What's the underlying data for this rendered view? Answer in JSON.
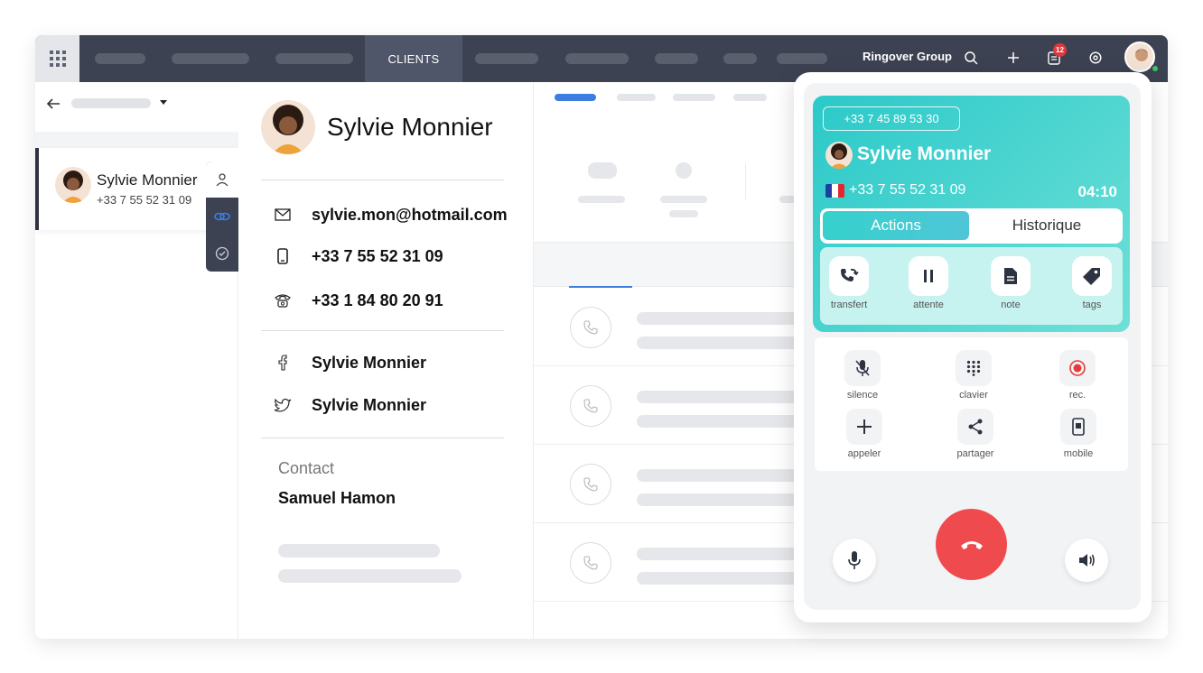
{
  "topbar": {
    "active_tab": "CLIENTS",
    "org_name": "Ringover Group",
    "notification_count": "12"
  },
  "contact_list": {
    "selected": {
      "name": "Sylvie Monnier",
      "phone": "+33 7 55 52 31 09"
    }
  },
  "contact_detail": {
    "name": "Sylvie Monnier",
    "email": "sylvie.mon@hotmail.com",
    "mobile": "+33 7 55 52 31 09",
    "landline": "+33 1 84 80 20 91",
    "facebook": "Sylvie Monnier",
    "twitter": "Sylvie Monnier",
    "contact_label": "Contact",
    "contact_owner": "Samuel Hamon"
  },
  "call": {
    "line_number": "+33 7 45 89 53 30",
    "caller_name": "Sylvie Monnier",
    "caller_phone": "+33 7 55 52 31 09",
    "duration": "04:10",
    "tabs": {
      "actions": "Actions",
      "history": "Historique"
    },
    "actions": [
      {
        "label": "transfert",
        "icon": "transfer-icon"
      },
      {
        "label": "attente",
        "icon": "pause-icon"
      },
      {
        "label": "note",
        "icon": "note-icon"
      },
      {
        "label": "tags",
        "icon": "tag-icon"
      }
    ],
    "controls": [
      {
        "label": "silence",
        "icon": "mute-icon"
      },
      {
        "label": "clavier",
        "icon": "keypad-icon"
      },
      {
        "label": "rec.",
        "icon": "record-icon"
      },
      {
        "label": "appeler",
        "icon": "plus-icon"
      },
      {
        "label": "partager",
        "icon": "share-icon"
      },
      {
        "label": "mobile",
        "icon": "mobile-icon"
      }
    ]
  },
  "colors": {
    "topbar": "#3d4252",
    "accent_teal": "#2bc9c9",
    "hangup_red": "#ef4b4f",
    "tab_blue": "#3b7ee0",
    "record_red": "#e63b3b"
  }
}
